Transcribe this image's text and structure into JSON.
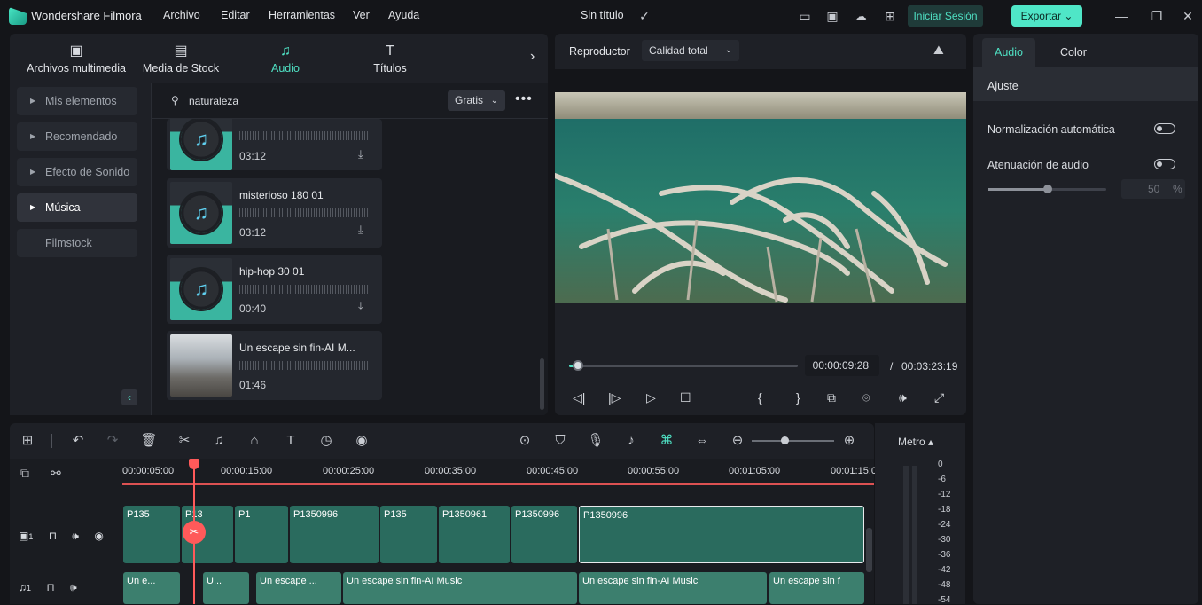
{
  "app": {
    "name": "Wondershare Filmora",
    "menus": [
      "Archivo",
      "Editar",
      "Herramientas",
      "Ver",
      "Ayuda"
    ],
    "project_title": "Sin título",
    "login": "Iniciar Sesión",
    "export": "Exportar"
  },
  "media": {
    "tabs": [
      {
        "label": "Archivos multimedia",
        "icon": "media-icon"
      },
      {
        "label": "Media de Stock",
        "icon": "cloud-folder-icon"
      },
      {
        "label": "Audio",
        "icon": "music-note-icon"
      },
      {
        "label": "Títulos",
        "icon": "title-t-icon"
      }
    ],
    "sidebar": [
      "Mis elementos",
      "Recomendado",
      "Efecto de Sonido",
      "Música",
      "Filmstock"
    ],
    "sidebar_active": "Música",
    "search": {
      "value": "naturaleza",
      "filter": "Gratis"
    },
    "cards": [
      {
        "title": "",
        "duration": "03:12"
      },
      {
        "title": "misterioso 180 01",
        "duration": "03:12"
      },
      {
        "title": "hip-hop 30 01",
        "duration": "00:40"
      },
      {
        "title": "Un escape sin fin-AI M...",
        "duration": "01:46"
      }
    ]
  },
  "player": {
    "label": "Reproductor",
    "quality": "Calidad total",
    "current_time": "00:00:09:28",
    "separator": "/",
    "total_time": "00:03:23:19",
    "progress": 0.04
  },
  "properties": {
    "tabs": [
      "Audio",
      "Color"
    ],
    "section": "Ajuste",
    "auto_normalize": "Normalización automática",
    "audio_ducking": "Atenuación de audio",
    "ducking_value": "50",
    "ducking_unit": "%",
    "ducking_level": 0.5
  },
  "timeline": {
    "ruler": [
      "00:00:05:00",
      "00:00:15:00",
      "00:00:25:00",
      "00:00:35:00",
      "00:00:45:00",
      "00:00:55:00",
      "00:01:05:00",
      "00:01:15:00"
    ],
    "video_clips": [
      "P135",
      "P13",
      "P1",
      "P1350996",
      "P135",
      "P1350961",
      "P1350996",
      "P1350996"
    ],
    "audio_clips": [
      "Un e...",
      "U...",
      "Un escape ...",
      "Un escape sin fin-AI Music",
      "Un escape sin fin-AI Music",
      "Un escape sin f"
    ],
    "track_video": "1",
    "track_audio": "1",
    "meter_label": "Metro",
    "meter_scale": [
      "0",
      "-6",
      "-12",
      "-18",
      "-24",
      "-30",
      "-36",
      "-42",
      "-48",
      "-54"
    ]
  },
  "colors": {
    "accent": "#4fe0c3",
    "playhead": "#ff5a5a"
  }
}
